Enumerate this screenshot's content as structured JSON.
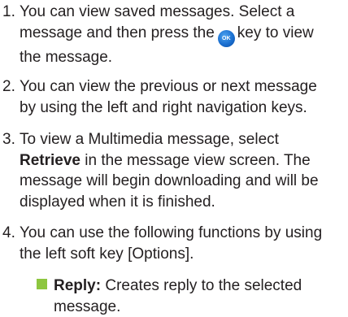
{
  "steps": [
    {
      "number": "1.",
      "line1": "You can view saved messages. Select a",
      "line2a": "message and then press the",
      "ok_key": "OK",
      "line2b": "key to view",
      "line3": "the message."
    },
    {
      "number": "2.",
      "line1": "You can view the previous or next message",
      "line2": "by using the left and right navigation keys."
    },
    {
      "number": "3.",
      "line1": "To view a Multimedia message, select",
      "bold": "Retrieve",
      "line2": "in the message view screen. The",
      "line3": "message will begin downloading and will be",
      "line4": "displayed when it is finished."
    },
    {
      "number": "4.",
      "line1": "You can use the following functions by using",
      "line2": "the left soft key [Options]."
    }
  ],
  "bullets": [
    {
      "term": "Reply:",
      "line1": "Creates reply to the selected",
      "line2": "message."
    }
  ],
  "colors": {
    "text": "#231f20",
    "bullet": "#8dc63f",
    "ok_key": "#1a6fd0"
  }
}
